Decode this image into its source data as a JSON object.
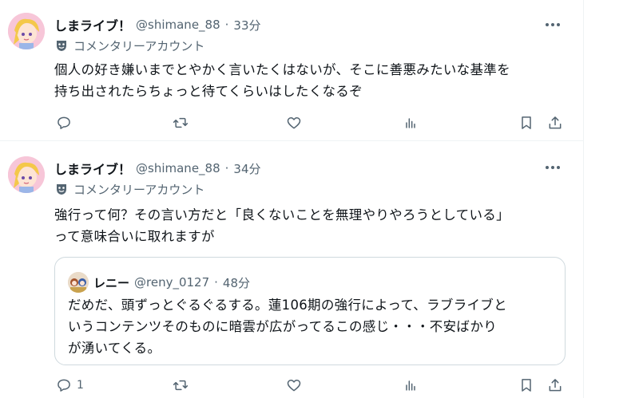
{
  "tweets": [
    {
      "display_name": "しまライブ！",
      "handle": "@shimane_88",
      "sep": "·",
      "time": "33分",
      "account_label": "コメンタリーアカウント",
      "text_line1": "個人の好き嫌いまでとやかく言いたくはないが、そこに善悪みたいな基準を",
      "text_line2": "持ち出されたらちょっと待てくらいはしたくなるぞ",
      "reply_count": ""
    },
    {
      "display_name": "しまライブ！",
      "handle": "@shimane_88",
      "sep": "·",
      "time": "34分",
      "account_label": "コメンタリーアカウント",
      "text_line1": "強行って何？その言い方だと「良くないことを無理やりやろうとしている」",
      "text_line2": "って意味合いに取れますが",
      "reply_count": "1",
      "quote": {
        "display_name": "レニー",
        "handle": "@reny_0127",
        "sep": "·",
        "time": "48分",
        "text_line1": "だめだ、頭ずっとぐるぐるする。蓮106期の強行によって、ラブライブと",
        "text_line2": "いうコンテンツそのものに暗雲が広がってるこの感じ・・・不安ばかり",
        "text_line3": "が湧いてくる。"
      }
    }
  ],
  "icons": [
    "avatar",
    "more-icon",
    "mask-icon",
    "reply-icon",
    "retweet-icon",
    "like-icon",
    "views-icon",
    "bookmark-icon",
    "share-icon"
  ],
  "colors": {
    "text": "#0f1419",
    "secondary": "#536471",
    "border": "#cfd9de",
    "divider": "#eff3f4"
  }
}
